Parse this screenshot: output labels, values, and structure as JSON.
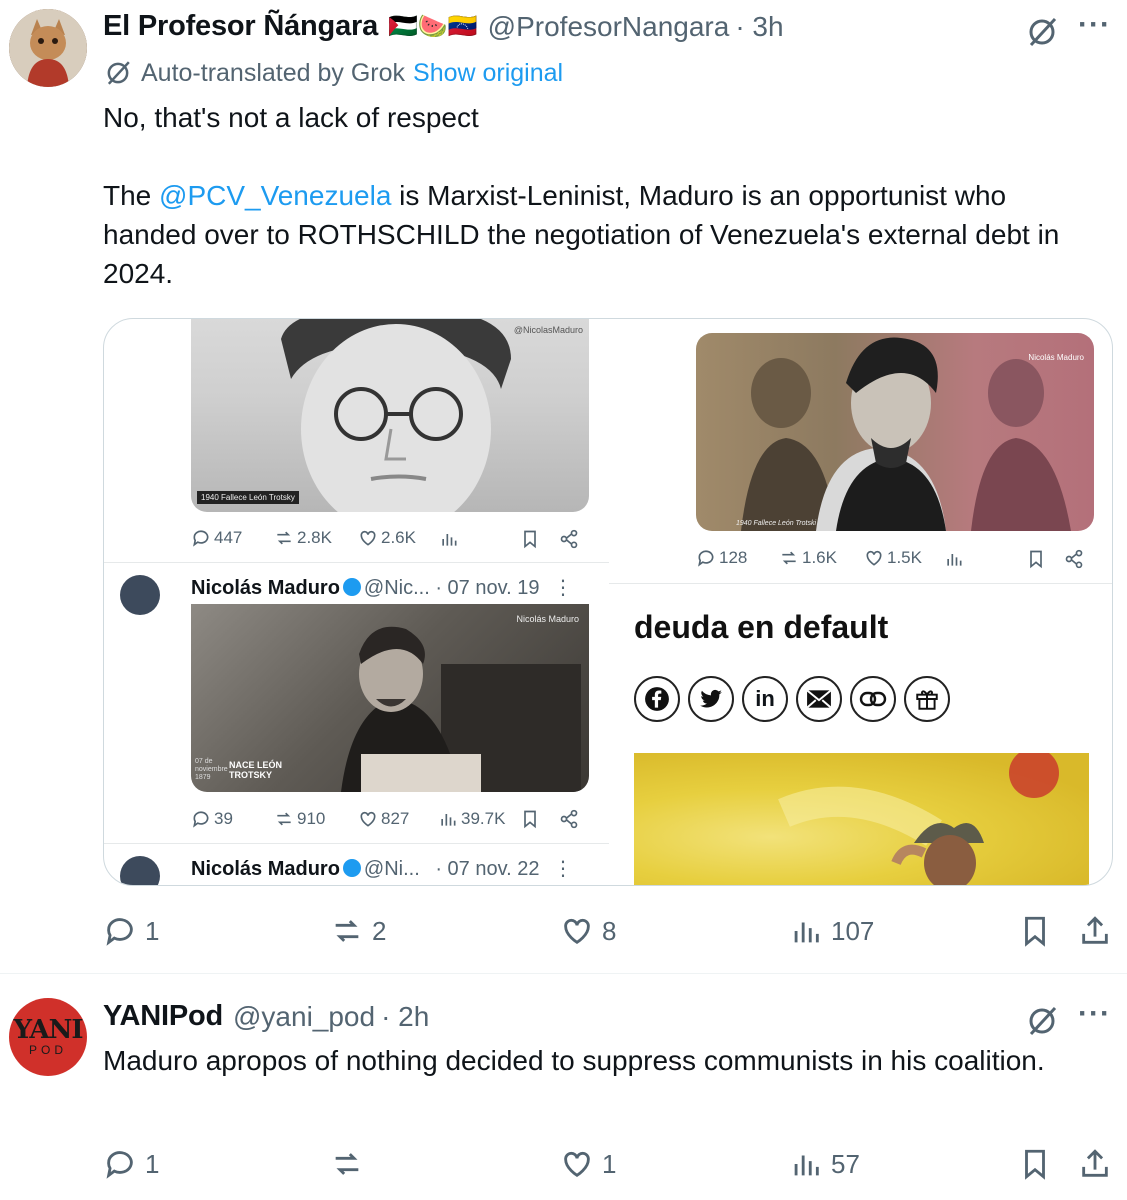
{
  "tweet1": {
    "name": "El Profesor Ñángara",
    "flags": "🇵🇸🍉🇻🇪",
    "handle": "@ProfesorNangara",
    "time": "· 3h",
    "translated_label": "Auto-translated by Grok",
    "show_original": "Show original",
    "line1": "No, that's not a lack of respect",
    "p2_before": "The ",
    "mention": "@PCV_Venezuela",
    "p2_after": " is Marxist-Leninist, Maduro is an opportunist who handed over to ROTHSCHILD the negotiation of Venezuela's external debt in 2024.",
    "replies": "1",
    "reposts": "2",
    "likes": "8",
    "views": "107"
  },
  "card": {
    "img1_watermark": "@NicolasMaduro",
    "img1_caption": "1940 Fallece León Trotsky",
    "img2_caption": "1940 Fallece León Trotski",
    "img2_watermark": "Nicolás Maduro",
    "img3_watermark": "Nicolás Maduro",
    "img3_caption_day": "07 de noviembre 1879",
    "img3_caption": "NACE LEÓN TROTSKY",
    "stats1": {
      "replies": "447",
      "reposts": "2.8K",
      "likes": "2.6K"
    },
    "stats2": {
      "replies": "128",
      "reposts": "1.6K",
      "likes": "1.5K"
    },
    "stats3": {
      "replies": "39",
      "reposts": "910",
      "likes": "827",
      "views": "39.7K"
    },
    "row1_name": "Nicolás Maduro",
    "row1_handle": "@Nic...",
    "row1_date": "· 07 nov. 19",
    "row2_name": "Nicolás Maduro",
    "row2_handle": "@Ni...",
    "row2_date": "· 07 nov. 22",
    "article_headline": "deuda en default",
    "share_icons": [
      "facebook-icon",
      "twitter-icon",
      "linkedin-icon",
      "email-icon",
      "link-icon",
      "gift-icon"
    ],
    "linkedin_label": "in"
  },
  "tweet2": {
    "name": "YANIPod",
    "handle": "@yani_pod",
    "time": "· 2h",
    "avatar_text_top": "YANI",
    "avatar_text_bottom": "POD",
    "text": "Maduro apropos of nothing decided to suppress communists in his coalition.",
    "replies": "1",
    "reposts": "",
    "likes": "1",
    "views": "57"
  },
  "colors": {
    "link": "#1d9bf0",
    "grey": "#536471",
    "text": "#0f1419",
    "avatar2_bg": "#d0302a"
  }
}
